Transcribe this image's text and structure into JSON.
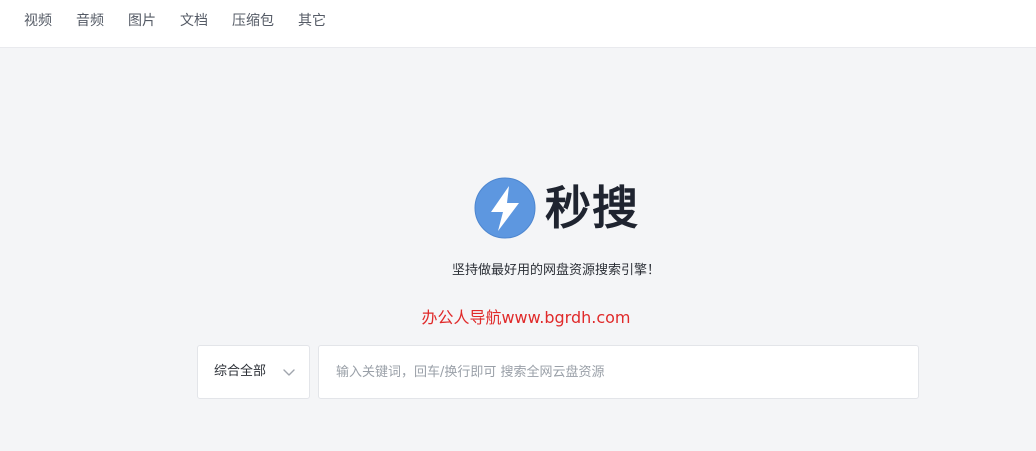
{
  "nav": {
    "items": [
      {
        "label": "视频"
      },
      {
        "label": "音频"
      },
      {
        "label": "图片"
      },
      {
        "label": "文档"
      },
      {
        "label": "压缩包"
      },
      {
        "label": "其它"
      }
    ]
  },
  "brand": {
    "name": "秒搜",
    "logo_icon": "lightning-bolt-icon",
    "accent_color": "#5d97e0",
    "tagline": "坚持做最好用的网盘资源搜索引擎！"
  },
  "watermark": {
    "text": "办公人导航www.bgrdh.com",
    "color": "#e02a2a"
  },
  "search": {
    "category_selected": "综合全部",
    "category_icon": "chevron-down-icon",
    "placeholder": "输入关键词，回车/换行即可 搜索全网云盘资源",
    "value": ""
  }
}
